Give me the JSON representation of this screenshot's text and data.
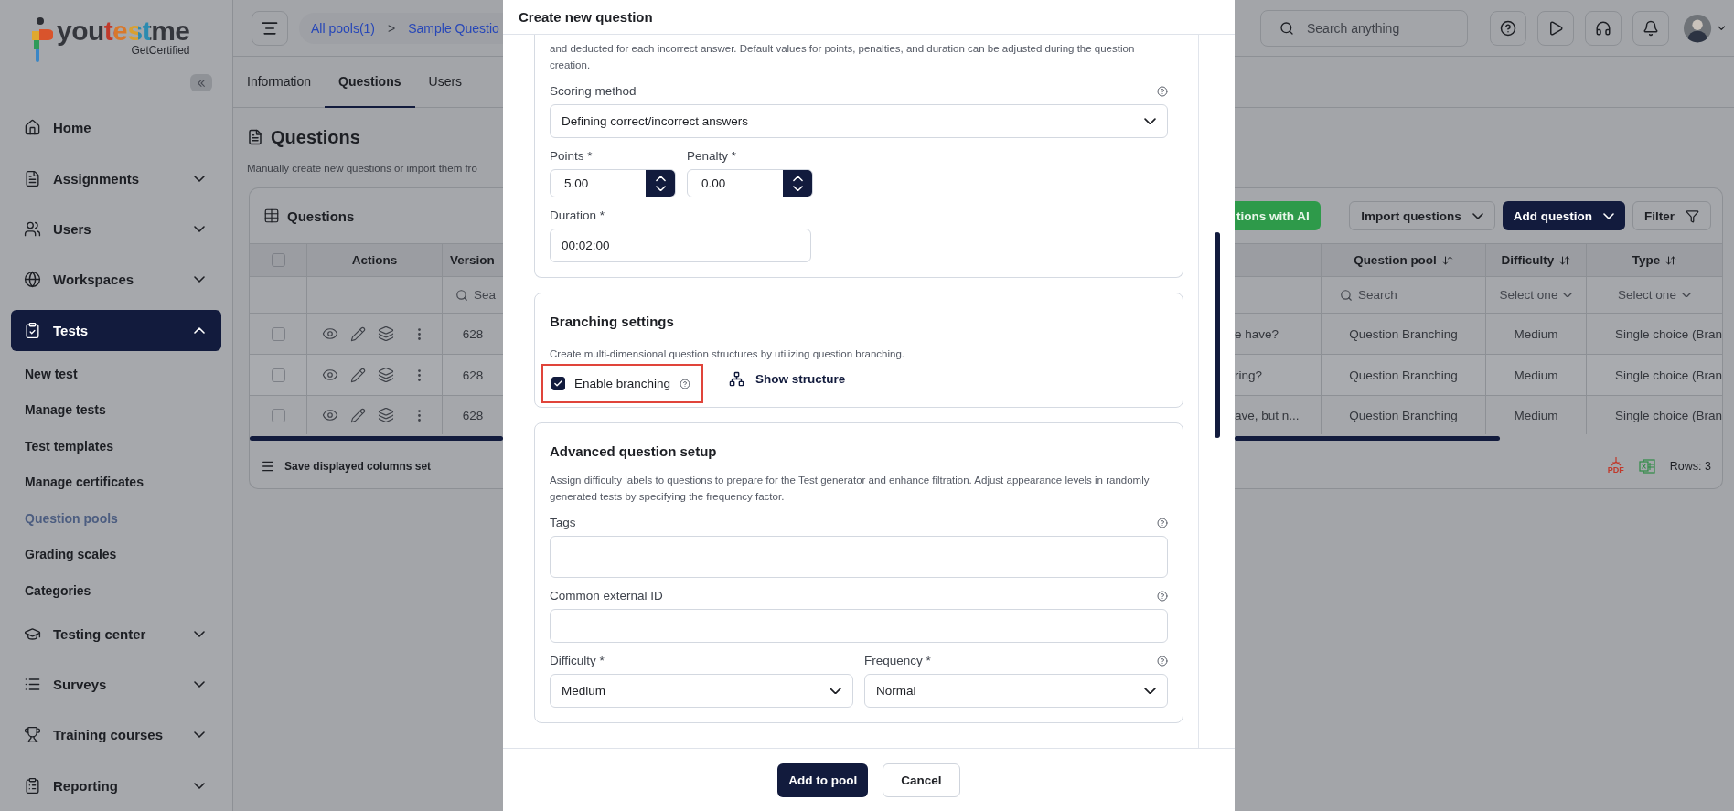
{
  "sidebar": {
    "logo": {
      "name": "youtestme",
      "tagline": "GetCertified"
    },
    "items": [
      {
        "label": "Home",
        "kind": "link",
        "selected": false
      },
      {
        "label": "Assignments",
        "kind": "group",
        "expanded": false,
        "selected": false
      },
      {
        "label": "Users",
        "kind": "group",
        "expanded": false,
        "selected": false
      },
      {
        "label": "Workspaces",
        "kind": "group",
        "expanded": false,
        "selected": false
      },
      {
        "label": "Tests",
        "kind": "group",
        "expanded": true,
        "selected": true,
        "children": [
          {
            "label": "New test",
            "selected": false
          },
          {
            "label": "Manage tests",
            "selected": false
          },
          {
            "label": "Test templates",
            "selected": false
          },
          {
            "label": "Manage certificates",
            "selected": false
          },
          {
            "label": "Question pools",
            "selected": true
          },
          {
            "label": "Grading scales",
            "selected": false
          },
          {
            "label": "Categories",
            "selected": false
          }
        ]
      },
      {
        "label": "Testing center",
        "kind": "group",
        "expanded": false,
        "selected": false
      },
      {
        "label": "Surveys",
        "kind": "group",
        "expanded": false,
        "selected": false
      },
      {
        "label": "Training courses",
        "kind": "group",
        "expanded": false,
        "selected": false
      },
      {
        "label": "Reporting",
        "kind": "group",
        "expanded": false,
        "selected": false
      }
    ]
  },
  "header": {
    "breadcrumb": [
      {
        "label": "All pools(1)"
      },
      {
        "label": "Sample Questio"
      }
    ],
    "separator": ">",
    "search": {
      "placeholder": "Search anything"
    }
  },
  "tabs": [
    {
      "label": "Information",
      "selected": false
    },
    {
      "label": "Questions",
      "selected": true
    },
    {
      "label": "Users",
      "selected": false
    }
  ],
  "page": {
    "title": "Questions",
    "subtitle": "Manually create new questions or import them fro"
  },
  "table": {
    "title": "Questions",
    "toolbar": [
      {
        "label": "tions with AI",
        "kind": "ai"
      },
      {
        "label": "Import questions",
        "kind": "dropdown"
      },
      {
        "label": "Add question",
        "kind": "primary"
      },
      {
        "label": "Filter",
        "kind": "filter"
      }
    ],
    "header_checked": false,
    "columns": [
      {
        "label": "Actions"
      },
      {
        "label": "Version",
        "filter": {
          "kind": "search",
          "text": "Sea"
        }
      },
      {},
      {
        "label": "Question pool",
        "sortable": true,
        "filter": {
          "kind": "search",
          "text": "Search"
        }
      },
      {
        "label": "Difficulty",
        "sortable": true,
        "filter": {
          "kind": "select",
          "text": "Select one"
        }
      },
      {
        "label": "Type",
        "sortable": true,
        "filter": {
          "kind": "select",
          "text": "Select one"
        }
      }
    ],
    "rows": [
      {
        "checked": false,
        "cells": [
          "",
          "628",
          "e have?",
          "Question Branching",
          "Medium",
          "Single choice (Bran"
        ]
      },
      {
        "checked": false,
        "cells": [
          "",
          "628",
          "ring?",
          "Question Branching",
          "Medium",
          "Single choice (Bran"
        ]
      },
      {
        "checked": false,
        "cells": [
          "",
          "628",
          "ave, but n...",
          "Question Branching",
          "Medium",
          "Single choice (Bran"
        ]
      }
    ],
    "footer": {
      "save_columns": "Save displayed columns set",
      "pdf_label": "PDF",
      "rows": "Rows: 3"
    }
  },
  "modal": {
    "title": "Create new question",
    "scoring": {
      "description": "and deducted for each incorrect answer. Default values for points, penalties, and duration can be adjusted during the question creation.",
      "method": {
        "label": "Scoring method",
        "help": true,
        "value": "Defining correct/incorrect answers"
      },
      "points": {
        "label": "Points *",
        "value": "5.00"
      },
      "penalty": {
        "label": "Penalty *",
        "value": "0.00"
      },
      "duration": {
        "label": "Duration *",
        "value": "00:02:00"
      }
    },
    "branching": {
      "title": "Branching settings",
      "description": "Create multi-dimensional question structures by utilizing question branching.",
      "checkbox": {
        "label": "Enable branching",
        "checked": true,
        "highlighted": true
      },
      "link": "Show structure"
    },
    "advanced": {
      "title": "Advanced question setup",
      "description": "Assign difficulty labels to questions to prepare for the Test generator and enhance filtration. Adjust appearance levels in randomly generated tests by specifying the frequency factor.",
      "tags": {
        "label": "Tags",
        "help": true
      },
      "external_id": {
        "label": "Common external ID",
        "help": true
      },
      "difficulty": {
        "label": "Difficulty *",
        "help": false,
        "value": "Medium"
      },
      "frequency": {
        "label": "Frequency *",
        "help": true,
        "value": "Normal"
      }
    },
    "buttons": [
      {
        "label": "Add to pool",
        "kind": "primary"
      },
      {
        "label": "Cancel",
        "kind": "secondary"
      }
    ]
  }
}
